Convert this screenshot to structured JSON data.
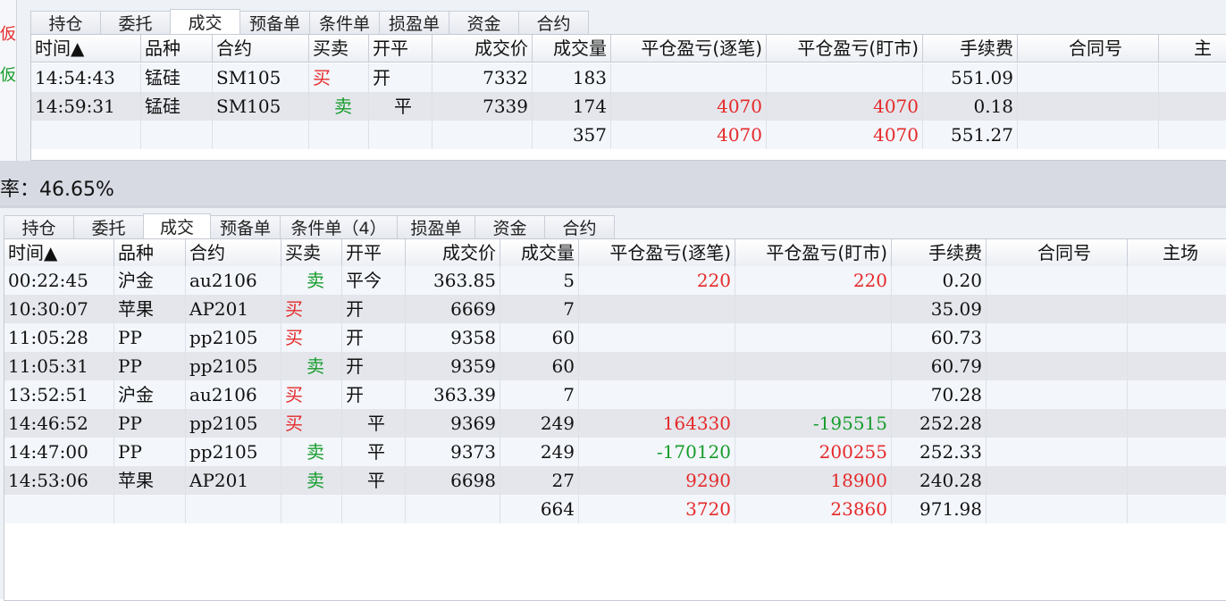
{
  "top_panel": {
    "left_strip": [
      "仮",
      "仮"
    ],
    "tabs": [
      "持仓",
      "委托",
      "成交",
      "预备单",
      "条件单",
      "损盈单",
      "资金",
      "合约"
    ],
    "active_tab": 2,
    "columns": [
      "时间▲",
      "品种",
      "合约",
      "买卖",
      "开平",
      "成交价",
      "成交量",
      "平仓盈亏(逐笔)",
      "平仓盈亏(盯市)",
      "手续费",
      "合同号",
      "主"
    ],
    "rows": [
      [
        "14:54:43",
        "锰硅",
        "SM105",
        "买",
        "开",
        "7332",
        "183",
        "",
        "",
        "551.09",
        ""
      ],
      [
        "14:59:31",
        "锰硅",
        "SM105",
        "卖",
        "平",
        "7339",
        "174",
        "4070",
        "4070",
        "0.18",
        ""
      ]
    ],
    "total": [
      "",
      "",
      "",
      "",
      "",
      "",
      "357",
      "4070",
      "4070",
      "551.27",
      ""
    ]
  },
  "ratio_text": "率：46.65%",
  "bottom_panel": {
    "tabs": [
      "持仓",
      "委托",
      "成交",
      "预备单",
      "条件单（4）",
      "损盈单",
      "资金",
      "合约"
    ],
    "active_tab": 2,
    "columns": [
      "时间▲",
      "品种",
      "合约",
      "买卖",
      "开平",
      "成交价",
      "成交量",
      "平仓盈亏(逐笔)",
      "平仓盈亏(盯市)",
      "手续费",
      "合同号",
      "主场"
    ],
    "rows": [
      [
        "00:22:45",
        "沪金",
        "au2106",
        "卖",
        "平今",
        "363.85",
        "5",
        "220",
        "220",
        "0.20",
        ""
      ],
      [
        "10:30:07",
        "苹果",
        "AP201",
        "买",
        "开",
        "6669",
        "7",
        "",
        "",
        "35.09",
        ""
      ],
      [
        "11:05:28",
        "PP",
        "pp2105",
        "买",
        "开",
        "9358",
        "60",
        "",
        "",
        "60.73",
        ""
      ],
      [
        "11:05:31",
        "PP",
        "pp2105",
        "卖",
        "开",
        "9359",
        "60",
        "",
        "",
        "60.79",
        ""
      ],
      [
        "13:52:51",
        "沪金",
        "au2106",
        "买",
        "开",
        "363.39",
        "7",
        "",
        "",
        "70.28",
        ""
      ],
      [
        "14:46:52",
        "PP",
        "pp2105",
        "买",
        "平",
        "9369",
        "249",
        "164330",
        "-195515",
        "252.28",
        ""
      ],
      [
        "14:47:00",
        "PP",
        "pp2105",
        "卖",
        "平",
        "9373",
        "249",
        "-170120",
        "200255",
        "252.33",
        ""
      ],
      [
        "14:53:06",
        "苹果",
        "AP201",
        "卖",
        "平",
        "6698",
        "27",
        "9290",
        "18900",
        "240.28",
        ""
      ]
    ],
    "total": [
      "",
      "",
      "",
      "",
      "",
      "",
      "664",
      "3720",
      "23860",
      "971.98",
      ""
    ]
  },
  "colors": {
    "buy": "#e52a2a",
    "sell": "#169c2b",
    "profit": "#e52a2a",
    "loss": "#169c2b"
  }
}
